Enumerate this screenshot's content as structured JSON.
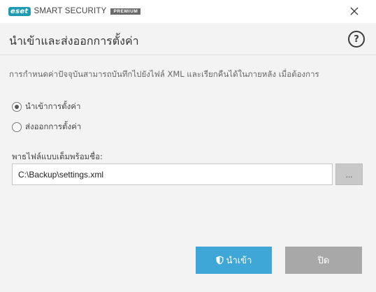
{
  "window": {
    "logo_text": "eset",
    "product_name": "SMART SECURITY",
    "edition_badge": "PREMIUM",
    "close_icon": "close-icon"
  },
  "header": {
    "title": "นำเข้าและส่งออกการตั้งค่า",
    "help_label": "?"
  },
  "main": {
    "description": "การกำหนดค่าปัจจุบันสามารถบันทึกไปยังไฟล์ XML และเรียกคืนได้ในภายหลัง เมื่อต้องการ",
    "options": [
      {
        "label": "นำเข้าการตั้งค่า",
        "checked": true
      },
      {
        "label": "ส่งออกการตั้งค่า",
        "checked": false
      }
    ],
    "path_label": "พาธไฟล์แบบเต็มพร้อมชื่อ:",
    "path_value": "C:\\Backup\\settings.xml",
    "browse_label": "..."
  },
  "footer": {
    "import_label": "นำเข้า",
    "close_label": "ปิด"
  },
  "colors": {
    "accent": "#3fa7d8",
    "brand": "#1f9bb1",
    "disabled_button": "#a8a8a8"
  }
}
